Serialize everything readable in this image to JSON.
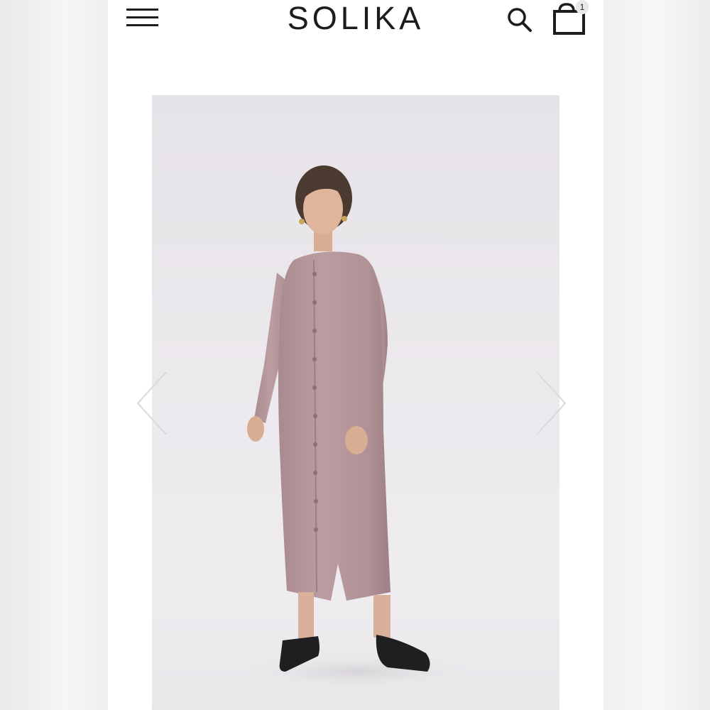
{
  "header": {
    "brand": "SOLIKA",
    "cart_count": "1",
    "icons": {
      "menu": "hamburger-menu-icon",
      "search": "search-icon",
      "cart": "shopping-bag-icon"
    }
  },
  "gallery": {
    "image": "product-photo-model-wearing-long-mauve-button-front-dress",
    "controls": {
      "prev": "chevron-left-icon",
      "next": "chevron-right-icon"
    }
  },
  "colors": {
    "background": "#ffffff",
    "text": "#1c1c1c",
    "dress": "#b89a9e",
    "photo_backdrop": "#e9e6ea"
  }
}
